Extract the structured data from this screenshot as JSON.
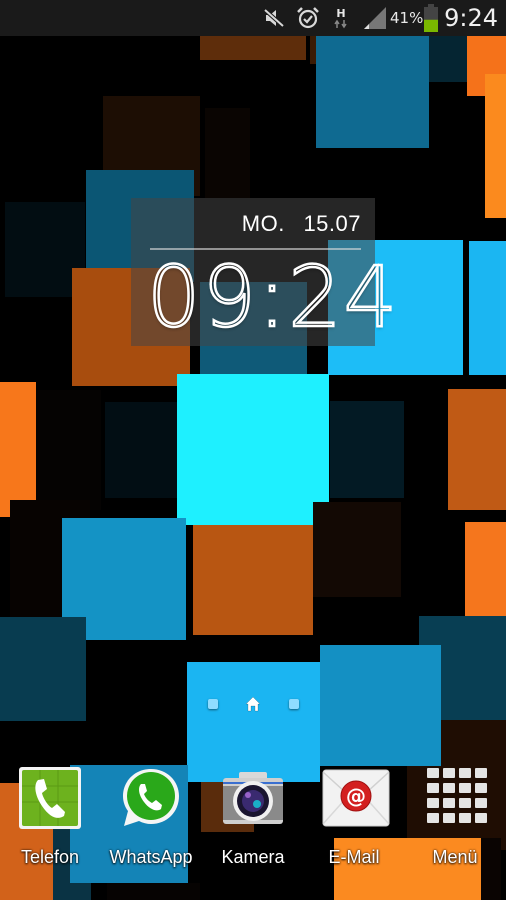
{
  "status_bar": {
    "icons": [
      {
        "name": "mute-icon",
        "label": "sound muted"
      },
      {
        "name": "alarm-icon",
        "label": "alarm set"
      },
      {
        "name": "hspa-data-icon",
        "label": "H"
      },
      {
        "name": "signal-icon",
        "label": "signal strength"
      },
      {
        "name": "battery-icon",
        "label": "battery"
      }
    ],
    "network_type": "H",
    "battery_percent": "41%",
    "battery_level": 0.41,
    "time": "9:24"
  },
  "clock_widget": {
    "weekday": "MO.",
    "date": "15.07",
    "time": "09:24"
  },
  "home_screens": {
    "count": 3,
    "current_index": 1,
    "home_icon": "home-icon"
  },
  "dock": {
    "items": [
      {
        "label": "Telefon",
        "icon": "phone-icon"
      },
      {
        "label": "WhatsApp",
        "icon": "whatsapp-icon"
      },
      {
        "label": "Kamera",
        "icon": "camera-icon"
      },
      {
        "label": "E-Mail",
        "icon": "email-icon"
      },
      {
        "label": "Menü",
        "icon": "app-drawer-icon"
      }
    ]
  },
  "colors": {
    "accent_cyan": "#1ef0ff",
    "accent_sky": "#1bbcf5",
    "accent_blue": "#1590c4",
    "accent_orange": "#f5791c",
    "accent_rust": "#b5560f",
    "battery_green": "#7ab800"
  }
}
